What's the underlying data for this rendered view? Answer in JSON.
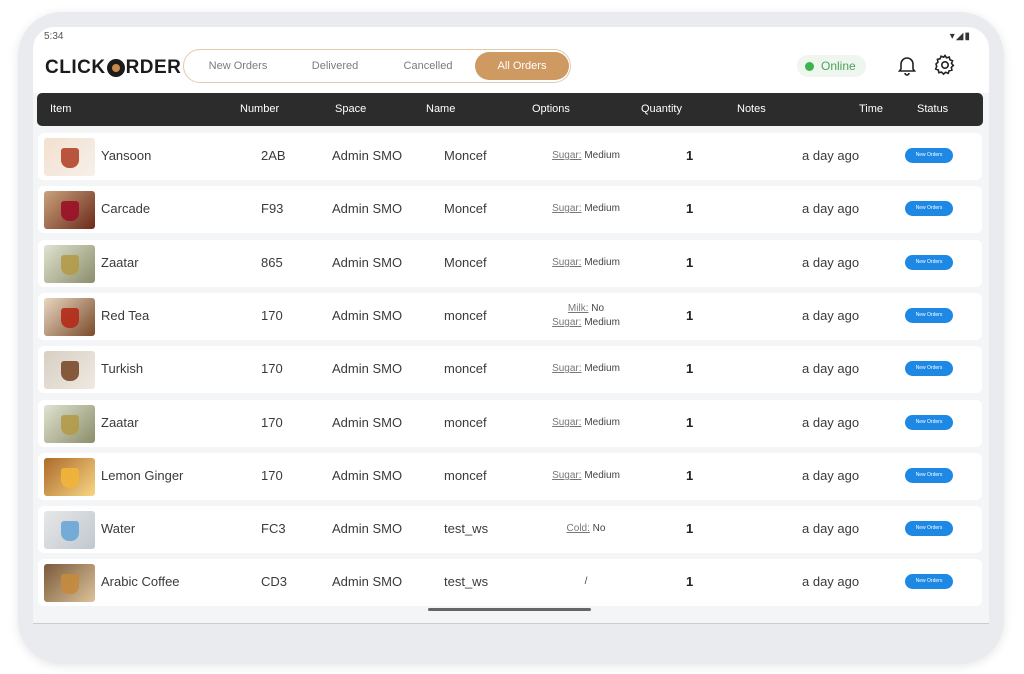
{
  "status_bar": {
    "time": "5:34",
    "system_icons": "▾◢▮"
  },
  "app": {
    "logo_text_left": "CLICK",
    "logo_text_right": "RDER"
  },
  "tabs": [
    {
      "label": "New Orders",
      "active": false
    },
    {
      "label": "Delivered",
      "active": false
    },
    {
      "label": "Cancelled",
      "active": false
    },
    {
      "label": "All Orders",
      "active": true
    }
  ],
  "status": {
    "label": "Online",
    "color": "#3bb54a"
  },
  "icons": {
    "notifications": "bell-icon",
    "settings": "gear-icon"
  },
  "colors": {
    "accent": "#cf9a62",
    "header_bg": "#2c2c2c",
    "badge": "#1e88e5"
  },
  "table": {
    "columns": [
      "Item",
      "Number",
      "Space",
      "Name",
      "Options",
      "Quantity",
      "Notes",
      "Time",
      "Status"
    ],
    "rows": [
      {
        "item": "Yansoon",
        "number": "2AB",
        "space": "Admin SMO",
        "name": "Moncef",
        "options": [
          {
            "key": "Sugar:",
            "value": "Medium"
          }
        ],
        "quantity": "1",
        "notes": "",
        "time": "a day ago",
        "status": "New Orders"
      },
      {
        "item": "Carcade",
        "number": "F93",
        "space": "Admin SMO",
        "name": "Moncef",
        "options": [
          {
            "key": "Sugar:",
            "value": "Medium"
          }
        ],
        "quantity": "1",
        "notes": "",
        "time": "a day ago",
        "status": "New Orders"
      },
      {
        "item": "Zaatar",
        "number": "865",
        "space": "Admin SMO",
        "name": "Moncef",
        "options": [
          {
            "key": "Sugar:",
            "value": "Medium"
          }
        ],
        "quantity": "1",
        "notes": "",
        "time": "a day ago",
        "status": "New Orders"
      },
      {
        "item": "Red Tea",
        "number": "170",
        "space": "Admin SMO",
        "name": "moncef",
        "options": [
          {
            "key": "Milk:",
            "value": "No"
          },
          {
            "key": "Sugar:",
            "value": "Medium"
          }
        ],
        "quantity": "1",
        "notes": "",
        "time": "a day ago",
        "status": "New Orders"
      },
      {
        "item": "Turkish",
        "number": "170",
        "space": "Admin SMO",
        "name": "moncef",
        "options": [
          {
            "key": "Sugar:",
            "value": "Medium"
          }
        ],
        "quantity": "1",
        "notes": "",
        "time": "a day ago",
        "status": "New Orders"
      },
      {
        "item": "Zaatar",
        "number": "170",
        "space": "Admin SMO",
        "name": "moncef",
        "options": [
          {
            "key": "Sugar:",
            "value": "Medium"
          }
        ],
        "quantity": "1",
        "notes": "",
        "time": "a day ago",
        "status": "New Orders"
      },
      {
        "item": "Lemon Ginger",
        "number": "170",
        "space": "Admin SMO",
        "name": "moncef",
        "options": [
          {
            "key": "Sugar:",
            "value": "Medium"
          }
        ],
        "quantity": "1",
        "notes": "",
        "time": "a day ago",
        "status": "New Orders"
      },
      {
        "item": "Water",
        "number": "FC3",
        "space": "Admin SMO",
        "name": "test_ws",
        "options": [
          {
            "key": "Cold:",
            "value": "No"
          }
        ],
        "quantity": "1",
        "notes": "",
        "time": "a day ago",
        "status": "New Orders"
      },
      {
        "item": "Arabic Coffee",
        "number": "CD3",
        "space": "Admin SMO",
        "name": "test_ws",
        "options": [
          {
            "key": "",
            "value": "/"
          }
        ],
        "quantity": "1",
        "notes": "",
        "time": "a day ago",
        "status": "New Orders"
      }
    ]
  }
}
